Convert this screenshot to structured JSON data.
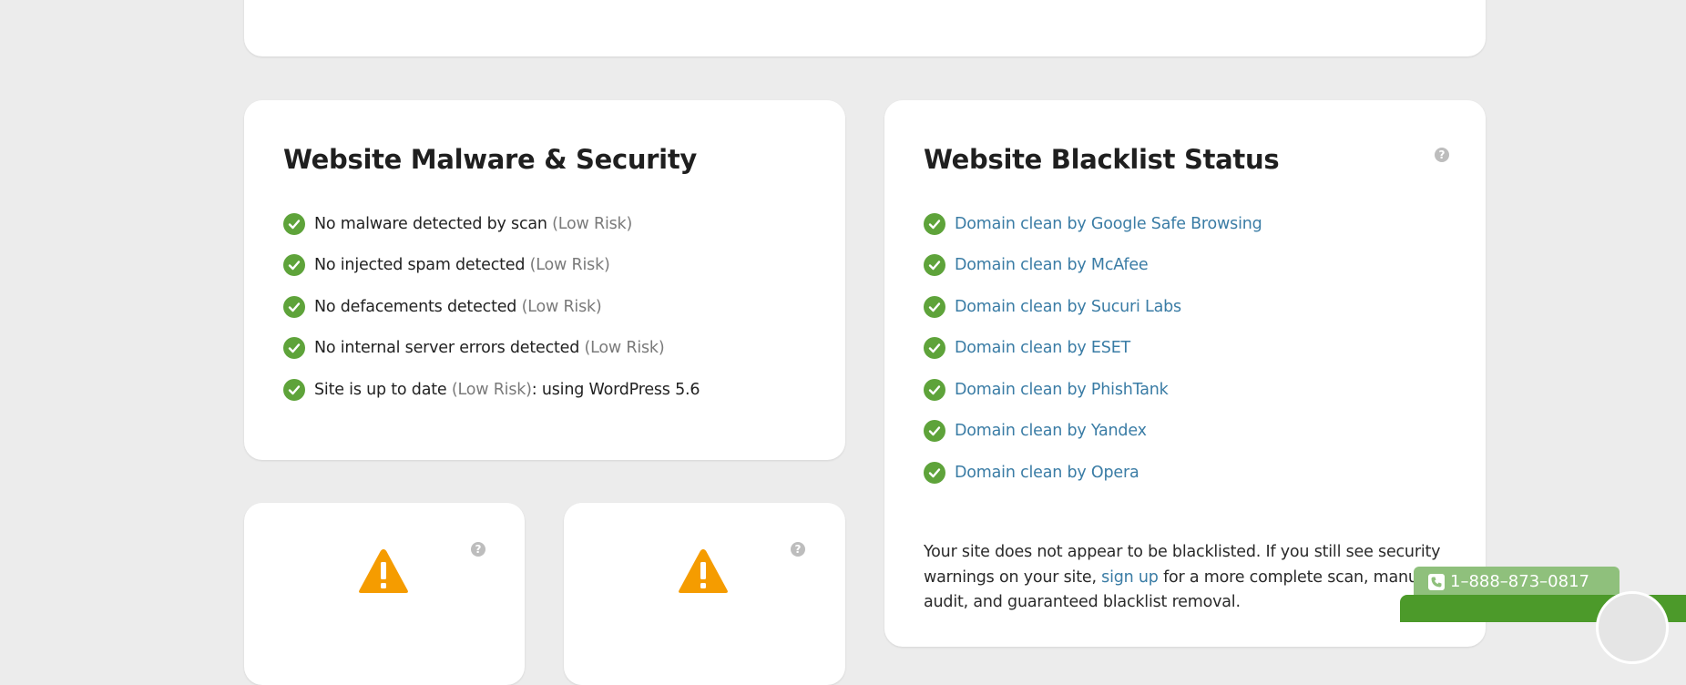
{
  "malware": {
    "title": "Website Malware & Security",
    "items": [
      {
        "text": "No malware detected by scan",
        "risk": "(Low Risk)",
        "suffix": ""
      },
      {
        "text": "No injected spam detected",
        "risk": "(Low Risk)",
        "suffix": ""
      },
      {
        "text": "No defacements detected",
        "risk": "(Low Risk)",
        "suffix": ""
      },
      {
        "text": "No internal server errors detected",
        "risk": "(Low Risk)",
        "suffix": ""
      },
      {
        "text": "Site is up to date",
        "risk": "(Low Risk)",
        "suffix": ": using WordPress 5.6"
      }
    ]
  },
  "blacklist": {
    "title": "Website Blacklist Status",
    "help": "?",
    "items": [
      "Domain clean by Google Safe Browsing",
      "Domain clean by McAfee",
      "Domain clean by Sucuri Labs",
      "Domain clean by ESET",
      "Domain clean by PhishTank",
      "Domain clean by Yandex",
      "Domain clean by Opera"
    ],
    "note_before": "Your site does not appear to be blacklisted. If you still see security warnings on your site, ",
    "note_link": "sign up",
    "note_after": " for a more complete scan, manual audit, and guaranteed blacklist removal."
  },
  "small_cards": [
    {
      "help": "?"
    },
    {
      "help": "?"
    }
  ],
  "contact": {
    "phone": "1–888–873–0817"
  },
  "colors": {
    "background": "#ececec",
    "check": "#5ea33a",
    "link": "#3a7ca5",
    "warning": "#f59c00",
    "risk": "#7a7a7a"
  }
}
